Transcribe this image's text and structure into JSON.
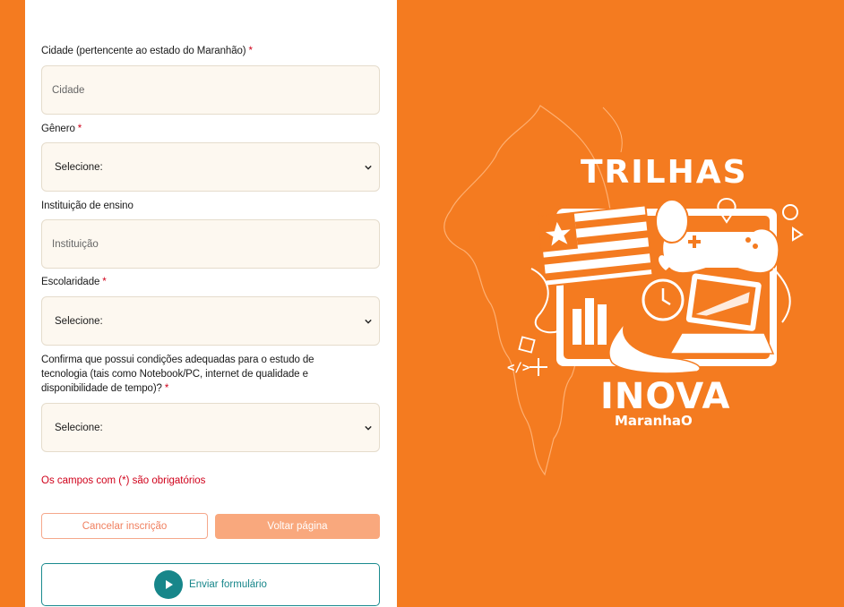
{
  "form": {
    "city": {
      "label": "Cidade (pertencente ao estado do Maranhão)",
      "required": "*",
      "placeholder": "Cidade"
    },
    "gender": {
      "label": "Gênero",
      "required": "*",
      "value": "Selecione:"
    },
    "institution": {
      "label": "Instituição de ensino",
      "placeholder": "Instituição"
    },
    "education": {
      "label": "Escolaridade",
      "required": "*",
      "value": "Selecione:"
    },
    "conditions": {
      "label": "Confirma que possui condições adequadas para o estudo de tecnologia (tais como Notebook/PC, internet de qualidade e disponibilidade de tempo)?",
      "required": "*",
      "value": "Selecione:"
    },
    "required_note": "Os campos com (*) são obrigatórios",
    "cancel_label": "Cancelar inscrição",
    "back_label": "Voltar página",
    "send_label": "Enviar formulário"
  },
  "branding": {
    "title": "TRILHAS",
    "logo_main": "INOVA",
    "logo_sub": "MaranhaO"
  },
  "colors": {
    "brand_orange": "#f47b20",
    "teal": "#17868a",
    "required_red": "#d0021b"
  }
}
